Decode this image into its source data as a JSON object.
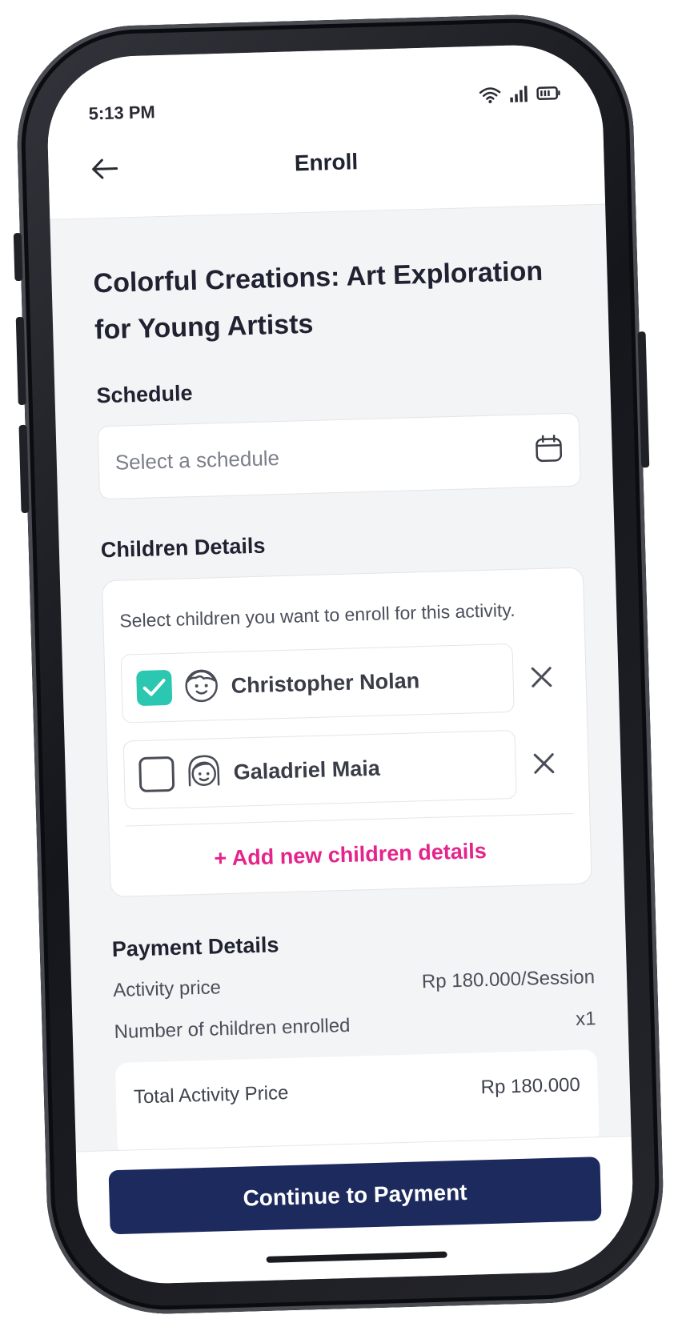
{
  "status_bar": {
    "time": "5:13 PM"
  },
  "app_bar": {
    "title": "Enroll"
  },
  "activity": {
    "title": "Colorful Creations: Art Exploration for Young Artists"
  },
  "schedule": {
    "label": "Schedule",
    "placeholder": "Select a schedule"
  },
  "children": {
    "label": "Children Details",
    "description": "Select children you want to enroll for this activity.",
    "items": [
      {
        "name": "Christopher Nolan",
        "checked": true,
        "avatar_icon": "boy-face-icon"
      },
      {
        "name": "Galadriel Maia",
        "checked": false,
        "avatar_icon": "girl-face-icon"
      }
    ],
    "add_label": "+ Add new children details"
  },
  "payment": {
    "label": "Payment Details",
    "activity_price_label": "Activity price",
    "activity_price_value": "Rp 180.000/Session",
    "children_count_label": "Number of children enrolled",
    "children_count_value": "x1",
    "total_label": "Total Activity Price",
    "total_value": "Rp 180.000"
  },
  "cta": {
    "label": "Continue to Payment"
  },
  "colors": {
    "accent": "#2cc7b0",
    "link": "#e5248b",
    "primary_button": "#1d2a5e"
  }
}
